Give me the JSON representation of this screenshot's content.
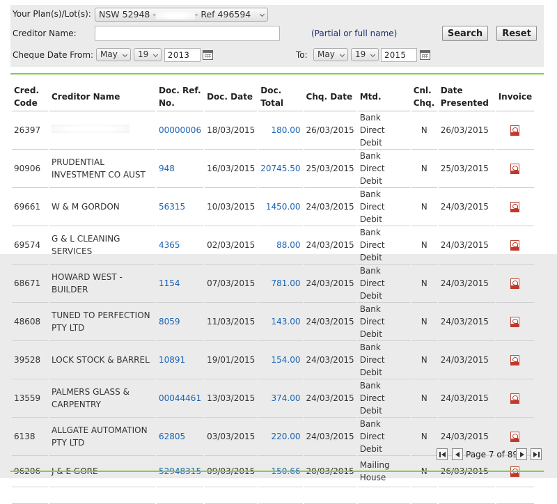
{
  "filter": {
    "plan_label": "Your Plan(s)/Lot(s):",
    "plan_value_prefix": "NSW 52948 -",
    "plan_value_suffix": "- Ref 496594",
    "creditor_label": "Creditor Name:",
    "creditor_value": "",
    "creditor_hint": "(Partial or full name)",
    "search_label": "Search",
    "reset_label": "Reset",
    "from_label": "Cheque Date From:",
    "from_month": "May",
    "from_day": "19",
    "from_year": "2013",
    "to_label": "To:",
    "to_month": "May",
    "to_day": "19",
    "to_year": "2015"
  },
  "table": {
    "headers": {
      "cred_code": [
        "Cred.",
        "Code"
      ],
      "creditor_name": "Creditor Name",
      "doc_ref": [
        "Doc. Ref.",
        "No."
      ],
      "doc_date": "Doc. Date",
      "doc_total": "Doc. Total",
      "chq_date": "Chq. Date",
      "mtd": "Mtd.",
      "cnl_chq": [
        "Cnl.",
        "Chq."
      ],
      "date_presented": [
        "Date",
        "Presented"
      ],
      "invoice": "Invoice"
    },
    "rows": [
      {
        "code": "26397",
        "name": [
          "",
          ""
        ],
        "doc_ref": "00000006",
        "doc_date": "18/03/2015",
        "total": "180.00",
        "chq_date": "26/03/2015",
        "mtd": [
          "Bank Direct",
          "Debit"
        ],
        "cnl": "N",
        "presented": "26/03/2015"
      },
      {
        "code": "90906",
        "name": [
          "PRUDENTIAL",
          "INVESTMENT CO AUST"
        ],
        "doc_ref": "948",
        "doc_date": "16/03/2015",
        "total": "20745.50",
        "chq_date": "25/03/2015",
        "mtd": [
          "Bank Direct",
          "Debit"
        ],
        "cnl": "N",
        "presented": "25/03/2015"
      },
      {
        "code": "69661",
        "name": [
          "W & M GORDON",
          ""
        ],
        "doc_ref": "56315",
        "doc_date": "10/03/2015",
        "total": "1450.00",
        "chq_date": "24/03/2015",
        "mtd": [
          "Bank Direct",
          "Debit"
        ],
        "cnl": "N",
        "presented": "24/03/2015"
      },
      {
        "code": "69574",
        "name": [
          "G & L CLEANING",
          "SERVICES"
        ],
        "doc_ref": "4365",
        "doc_date": "02/03/2015",
        "total": "88.00",
        "chq_date": "24/03/2015",
        "mtd": [
          "Bank Direct",
          "Debit"
        ],
        "cnl": "N",
        "presented": "24/03/2015"
      },
      {
        "code": "68671",
        "name": [
          "HOWARD WEST -",
          "BUILDER"
        ],
        "doc_ref": "1154",
        "doc_date": "07/03/2015",
        "total": "781.00",
        "chq_date": "24/03/2015",
        "mtd": [
          "Bank Direct",
          "Debit"
        ],
        "cnl": "N",
        "presented": "24/03/2015"
      },
      {
        "code": "48608",
        "name": [
          "TUNED TO PERFECTION",
          "PTY LTD"
        ],
        "doc_ref": "8059",
        "doc_date": "11/03/2015",
        "total": "143.00",
        "chq_date": "24/03/2015",
        "mtd": [
          "Bank Direct",
          "Debit"
        ],
        "cnl": "N",
        "presented": "24/03/2015"
      },
      {
        "code": "39528",
        "name": [
          "LOCK STOCK & BARREL",
          ""
        ],
        "doc_ref": "10891",
        "doc_date": "19/01/2015",
        "total": "154.00",
        "chq_date": "24/03/2015",
        "mtd": [
          "Bank Direct",
          "Debit"
        ],
        "cnl": "N",
        "presented": "24/03/2015"
      },
      {
        "code": "13559",
        "name": [
          "PALMERS GLASS &",
          "CARPENTRY"
        ],
        "doc_ref": "00044461",
        "doc_date": "13/03/2015",
        "total": "374.00",
        "chq_date": "24/03/2015",
        "mtd": [
          "Bank Direct",
          "Debit"
        ],
        "cnl": "N",
        "presented": "24/03/2015"
      },
      {
        "code": "6138",
        "name": [
          "ALLGATE AUTOMATION",
          "PTY LTD"
        ],
        "doc_ref": "62805",
        "doc_date": "03/03/2015",
        "total": "220.00",
        "chq_date": "24/03/2015",
        "mtd": [
          "Bank Direct",
          "Debit"
        ],
        "cnl": "N",
        "presented": "24/03/2015"
      },
      {
        "code": "96206",
        "name": [
          "J & E GORE",
          ""
        ],
        "doc_ref": "52948315",
        "doc_date": "09/03/2015",
        "total": "150.66",
        "chq_date": "20/03/2015",
        "mtd": [
          "Mailing",
          "House"
        ],
        "cnl": "N",
        "presented": "26/03/2015"
      }
    ]
  },
  "pager": {
    "text": "Page 7 of 89"
  },
  "icons": {
    "invoice": "pdf-file-icon",
    "calendar": "calendar-icon"
  },
  "colors": {
    "link": "#1a63b4",
    "accent_line": "#7ccf4e",
    "panel": "#ebebeb"
  }
}
